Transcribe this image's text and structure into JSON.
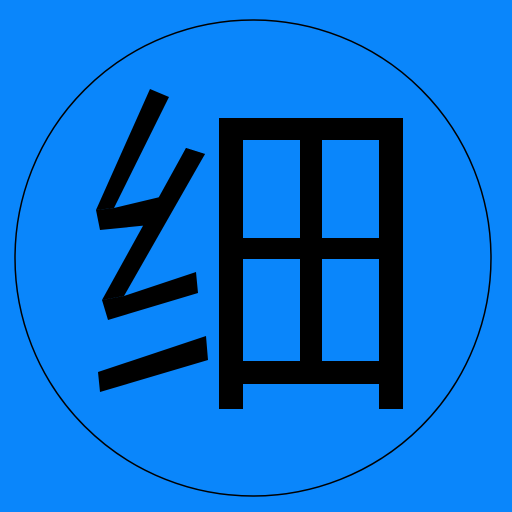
{
  "background_color": "#0a86fb",
  "ring_color": "#000000",
  "glyph_color": "#000000",
  "glyph": "细"
}
